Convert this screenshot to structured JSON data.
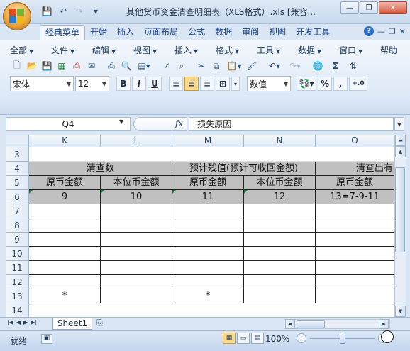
{
  "window": {
    "title": "其他货币资金清查明细表（XLS格式）.xls  [兼容...",
    "minimize_glyph": "—",
    "restore_glyph": "❐",
    "close_glyph": "✕"
  },
  "quick_access": {
    "save_glyph": "💾",
    "undo_glyph": "↶",
    "redo_glyph": "↷",
    "customize_glyph": "▾"
  },
  "ribbon_tabs": [
    "经典菜单",
    "开始",
    "插入",
    "页面布局",
    "公式",
    "数据",
    "审阅",
    "视图",
    "开发工具"
  ],
  "ribbon_right": {
    "help_glyph": "?",
    "min_glyph": "—",
    "restore_glyph": "❐",
    "close_glyph": "✕"
  },
  "menu_bar": [
    "全部",
    "文件",
    "编辑",
    "视图",
    "插入",
    "格式",
    "工具",
    "数据",
    "窗口",
    "帮助"
  ],
  "toolbar": {
    "font_name": "宋体",
    "font_size": "12",
    "bold": "B",
    "italic": "I",
    "underline": "U",
    "number_format": "数值",
    "percent": "%",
    "comma": ",",
    "increase_decimal": "+.0",
    "sum": "Σ"
  },
  "formula_bar": {
    "name_box": "Q4",
    "fx": "fx",
    "content": "'损失原因"
  },
  "grid": {
    "columns": [
      "K",
      "L",
      "M",
      "N",
      "O"
    ],
    "rows": [
      "3",
      "4",
      "5",
      "6",
      "7",
      "8",
      "9",
      "10",
      "11",
      "12",
      "13",
      "14"
    ],
    "row4": {
      "group_KL": "清查数",
      "group_MN": "预计残值(预计可收回金额)",
      "group_O": "清查出有"
    },
    "row5": [
      "原币金额",
      "本位币金额",
      "原币金额",
      "本位币金额",
      "原币金额"
    ],
    "row6": [
      "9",
      "10",
      "11",
      "12",
      "13=7-9-11"
    ],
    "row13": [
      "*",
      "",
      "*",
      "",
      ""
    ]
  },
  "sheets": {
    "active": "Sheet1"
  },
  "status": {
    "text": "就绪",
    "zoom": "100%",
    "zoom_fraction": 0.5
  },
  "colors": {
    "header_fill": "#c0c0c0",
    "ribbon": "#dbe6f4",
    "accent": "#15428b"
  }
}
